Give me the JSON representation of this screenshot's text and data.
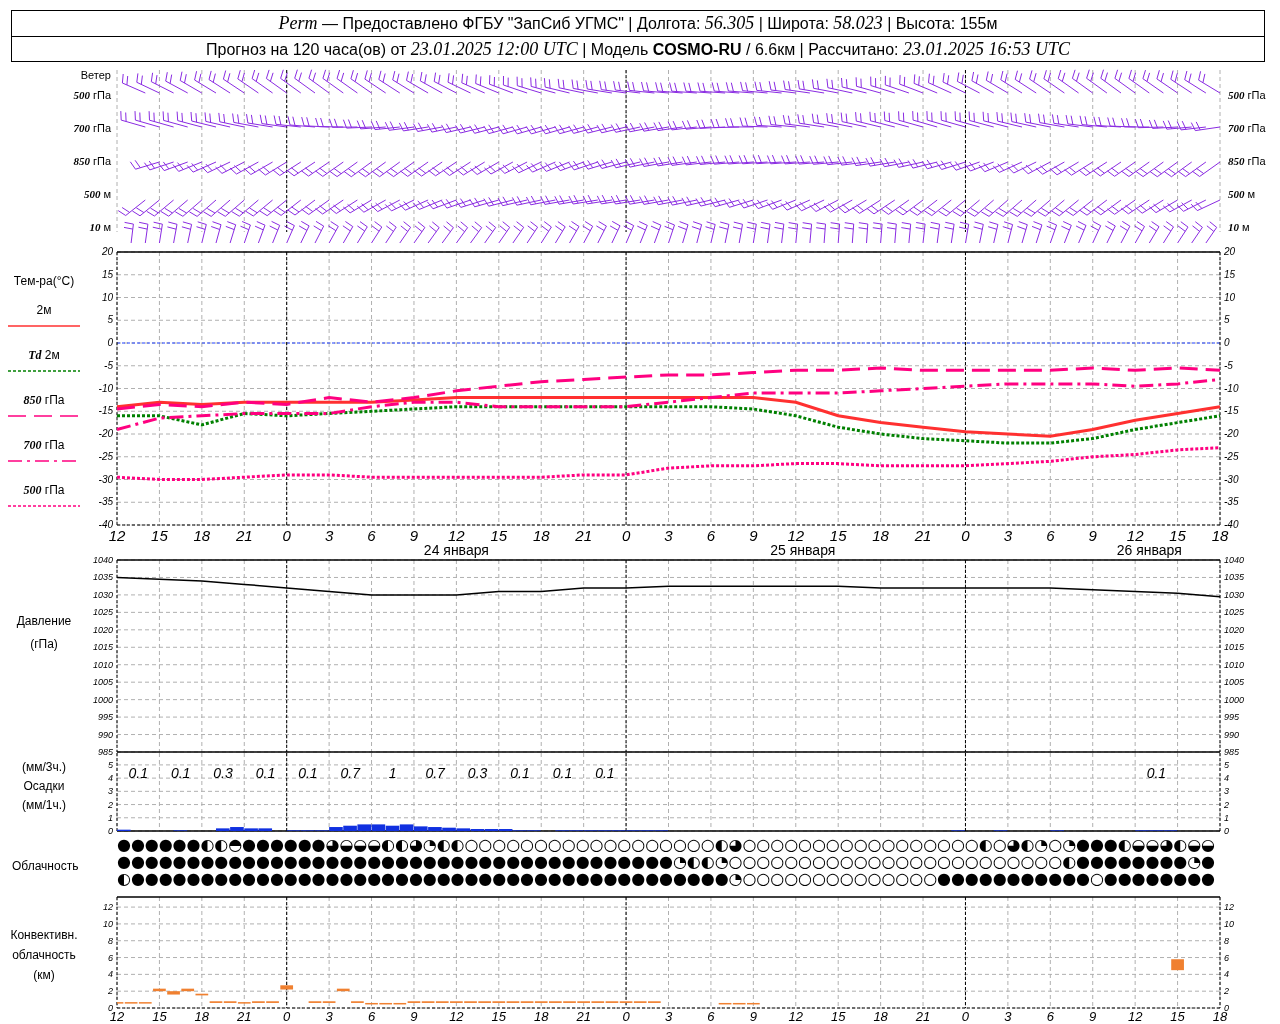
{
  "header": {
    "lines": [
      "*Perm* — Предоставлено ФГБУ \"ЗапСиб УГМС\" | Долгота: *56.305* | Широта: *58.023* | Высота: 155м",
      "Прогноз на 120 часа(ов) от *23.01.2025 12:00 UTC*  | Модель **COSMO-RU** / 6.6км | Рассчитано: *23.01.2025 16:53 UTC*"
    ]
  },
  "wind": {
    "title": "Ветер",
    "levels": [
      {
        "left_label": "*500* гПа",
        "right_label": "*500* гПа"
      },
      {
        "left_label": "*700* гПа",
        "right_label": "*700* гПа"
      },
      {
        "left_label": "*850* гПа",
        "right_label": "*850* гПа"
      },
      {
        "left_label": "*500* м",
        "right_label": "*500* м"
      },
      {
        "left_label": "*10*  м",
        "right_label": "*10*  м"
      }
    ]
  },
  "temperature": {
    "title": "Тем-ра(°С)",
    "date_labels": [
      "24 января",
      "25 января",
      "26 января"
    ],
    "right_axis_labels": [
      "20",
      "15",
      "10",
      "5",
      "0",
      "-5",
      "-10",
      "-15",
      "-20",
      "-25",
      "-30",
      "-35",
      "-40"
    ],
    "chart_data": {
      "type": "line",
      "grid": true,
      "categories": [
        "12",
        "15",
        "18",
        "21",
        "0",
        "3",
        "6",
        "9",
        "12",
        "15",
        "18",
        "21",
        "0",
        "3",
        "6",
        "9",
        "12",
        "15",
        "18",
        "21",
        "0",
        "3",
        "6",
        "9",
        "12",
        "15",
        "18"
      ],
      "ylim": [
        -40,
        20
      ],
      "yticks": [
        20,
        15,
        10,
        5,
        0,
        -5,
        -10,
        -15,
        -20,
        -25,
        -30,
        -35,
        -40
      ],
      "ref_lines": [
        {
          "axis": "y",
          "value": 0,
          "color": "#2040ff",
          "line_style": "dotted"
        }
      ],
      "series": [
        {
          "name": "2м",
          "color": "#ff3030",
          "line_style": "solid",
          "values": [
            -14,
            -13,
            -13.5,
            -13,
            -13,
            -13,
            -13,
            -12.5,
            -12,
            -12,
            -12,
            -12,
            -12,
            -12,
            -12,
            -12,
            -13,
            -16,
            -17.5,
            -18.5,
            -19.5,
            -20,
            -20.5,
            -19,
            -17,
            -15.5,
            -14
          ]
        },
        {
          "name": "*Td*  2м",
          "color": "#008000",
          "line_style": "dotted",
          "values": [
            -16,
            -16,
            -18,
            -15.5,
            -16,
            -15.5,
            -15,
            -14.5,
            -14,
            -14,
            -14,
            -14,
            -14,
            -14,
            -14,
            -14.5,
            -16,
            -18.5,
            -20,
            -21,
            -21.5,
            -22,
            -22,
            -21,
            -19,
            -17.5,
            -16
          ]
        },
        {
          "name": "*850* гПа",
          "color": "#ff0080",
          "line_style": "dashed",
          "values": [
            -14.5,
            -13.5,
            -14,
            -13,
            -13.5,
            -12,
            -13,
            -12,
            -10.5,
            -9.5,
            -8.5,
            -8,
            -7.5,
            -7,
            -7,
            -6.5,
            -6,
            -6,
            -5.5,
            -6,
            -6,
            -6,
            -6,
            -5.5,
            -6,
            -5.5,
            -6
          ]
        },
        {
          "name": "*700* гПа",
          "color": "#ff0080",
          "line_style": "dashdot",
          "values": [
            -19,
            -16.5,
            -16,
            -15.5,
            -15.5,
            -15.5,
            -14,
            -13,
            -13,
            -14,
            -14,
            -14,
            -14,
            -13,
            -12,
            -11,
            -11,
            -11,
            -10.5,
            -10,
            -9.5,
            -9,
            -9,
            -9,
            -9.5,
            -9,
            -8
          ]
        },
        {
          "name": "*500* гПа",
          "color": "#ff0080",
          "line_style": "dotted",
          "values": [
            -29.5,
            -30,
            -30,
            -29.5,
            -29,
            -29,
            -29.5,
            -29.5,
            -29.5,
            -29.5,
            -29.5,
            -29,
            -29,
            -27.5,
            -27,
            -27,
            -26.5,
            -26.5,
            -27,
            -27,
            -27,
            -26.5,
            -26,
            -25,
            -24.5,
            -23.5,
            -23
          ]
        }
      ]
    }
  },
  "pressure": {
    "labels": [
      "Давление",
      "(гПа)"
    ],
    "right_axis_labels": [
      "1040",
      "1035",
      "1030",
      "1025",
      "1020",
      "1015",
      "1010",
      "1005",
      "1000",
      "995",
      "990",
      "985"
    ],
    "chart_data": {
      "type": "line",
      "grid": true,
      "categories": [
        null,
        null,
        null,
        null,
        null,
        null,
        null,
        null,
        null,
        null,
        null,
        null,
        null,
        null,
        null,
        null,
        null,
        null,
        null,
        null,
        null,
        null,
        null,
        null,
        null,
        null,
        null
      ],
      "ylim": [
        985,
        1040
      ],
      "yticks": [
        1040,
        1035,
        1030,
        1025,
        1020,
        1015,
        1010,
        1005,
        1000,
        995,
        990,
        985
      ],
      "series": [
        {
          "color": "#000000",
          "line_style": "solid",
          "values": [
            1035,
            1034.5,
            1034,
            1033,
            1032,
            1031,
            1030,
            1030,
            1030,
            1031,
            1031,
            1032,
            1032,
            1032.5,
            1032.5,
            1032.5,
            1032.5,
            1032.5,
            1032,
            1032,
            1032,
            1032,
            1032,
            1031.5,
            1031,
            1030.5,
            1029.5
          ]
        }
      ]
    }
  },
  "precipitation": {
    "labels": [
      "(мм/3ч.)",
      "Осадки",
      "(мм/1ч.)"
    ],
    "totals_3h": [
      "0.1",
      "0.1",
      "0.3",
      "0.1",
      "0.1",
      "0.7",
      "1",
      "0.7",
      "0.3",
      "0.1",
      "0.1",
      "0.1",
      "0.1"
    ],
    "right_axis_labels": [
      "5",
      "4",
      "3",
      "2",
      "1",
      "0"
    ],
    "chart_data": {
      "type": "bar",
      "grid": true,
      "categories": [
        null,
        null,
        null,
        null,
        null,
        null,
        null,
        null,
        null,
        null,
        null,
        null,
        null,
        null,
        null,
        null,
        null,
        null,
        null,
        null,
        null,
        null,
        null,
        null,
        null,
        null,
        null,
        null,
        null,
        null,
        null,
        null,
        null,
        null,
        null,
        null,
        null,
        null,
        null,
        null,
        null,
        null,
        null,
        null,
        null,
        null,
        null,
        null,
        null,
        null,
        null,
        null,
        null,
        null,
        null,
        null,
        null,
        null,
        null,
        null,
        null,
        null,
        null,
        null,
        null,
        null,
        null,
        null,
        null,
        null,
        null,
        null,
        null,
        null,
        null,
        null,
        null,
        null
      ],
      "ylim": [
        0,
        5.9
      ],
      "yticks": [
        5,
        4,
        3,
        2,
        1,
        0
      ],
      "series": [
        {
          "color": "#1030e0",
          "values": [
            0.1,
            0,
            0,
            0,
            0.05,
            0,
            0,
            0.2,
            0.3,
            0.2,
            0.2,
            0,
            0.05,
            0.05,
            0.05,
            0.3,
            0.4,
            0.5,
            0.5,
            0.4,
            0.5,
            0.35,
            0.3,
            0.25,
            0.2,
            0.15,
            0.15,
            0.15,
            0.05,
            0.05,
            0,
            0.05,
            0.05,
            0.05,
            0.05,
            0.05,
            0.05,
            0.05,
            0.05,
            0,
            0,
            0,
            0,
            0,
            0,
            0,
            0,
            0,
            0,
            0,
            0,
            0,
            0,
            0,
            0,
            0,
            0,
            0,
            0,
            0.05,
            0,
            0,
            0.05,
            0,
            0,
            0,
            0.05,
            0,
            0,
            0,
            0,
            0,
            0.05,
            0.05,
            0.05,
            0,
            0,
            0
          ]
        }
      ]
    }
  },
  "cloudiness": {
    "label": "Облачность",
    "rows": [
      "●●●●●●◐◐◓●●●●●●◕◒◒◒◐◐◕◔◐◐○○○○○○○○○○○○○○○○○○◐◕○○○○○○○○○○○○○○○○○◐○◕◐◔○◔●●●◐◒◒◕◐◒◒",
      "●●●●●●●●●●●●●●●●●●●●●●●●●●●●●●●●●●●●●●●●◔◐◐◔○○○○○○○○○○○○○○○○○○○○○○○○◐●●●●●●●●◔●",
      "◐●●●●●●●●●●●●●●●●●●●●●●●●●●●●●●●●●●●●●●●●●●●◔○○○○○○○○○○○○○○●●●●●●●●●●●○●●●●●●●●"
    ]
  },
  "convective_clouds": {
    "labels": [
      "Конвективн.",
      "облачность",
      "(км)"
    ],
    "right_axis_labels": [
      "12",
      "10",
      "8",
      "6",
      "4",
      "2",
      "0"
    ],
    "chart_data": {
      "type": "candlestick",
      "grid": true,
      "categories": [
        "12",
        null,
        null,
        "15",
        null,
        null,
        "18",
        null,
        null,
        "21",
        null,
        null,
        "0",
        null,
        null,
        "3",
        null,
        null,
        "6",
        null,
        null,
        "9",
        null,
        null,
        "12",
        null,
        null,
        "15",
        null,
        null,
        "18",
        null,
        null,
        "21",
        null,
        null,
        "0",
        null,
        null,
        "3",
        null,
        null,
        "6",
        null,
        null,
        "9",
        null,
        null,
        "12",
        null,
        null,
        "15",
        null,
        null,
        "18",
        null,
        null,
        "21",
        null,
        null,
        "0",
        null,
        null,
        "3",
        null,
        null,
        "6",
        null,
        null,
        "9",
        null,
        null,
        "12",
        null,
        null,
        "15",
        null,
        null,
        "18"
      ],
      "ylim": [
        0,
        13.2
      ],
      "yticks": [
        12,
        10,
        8,
        6,
        4,
        2,
        0
      ],
      "series": [
        {
          "color": "#f08030",
          "ohlc": [
            [
              0.6,
              0.7,
              0.6,
              0.7
            ],
            [
              0.6,
              0.7,
              0.6,
              0.7
            ],
            [
              0.6,
              0.7,
              0.6,
              0.7
            ],
            [
              2.0,
              2.3,
              2.0,
              2.3
            ],
            [
              1.6,
              2.0,
              1.6,
              2.0
            ],
            [
              2.0,
              2.3,
              2.0,
              2.3
            ],
            [
              1.5,
              1.7,
              1.5,
              1.7
            ],
            [
              0.6,
              0.8,
              0.6,
              0.8
            ],
            [
              0.6,
              0.8,
              0.6,
              0.8
            ],
            [
              0.6,
              0.7,
              0.6,
              0.7
            ],
            [
              0.6,
              0.8,
              0.6,
              0.8
            ],
            [
              0.6,
              0.8,
              0.6,
              0.8
            ],
            [
              2.2,
              2.7,
              2.2,
              2.7
            ],
            null,
            [
              0.6,
              0.8,
              0.6,
              0.8
            ],
            [
              0.6,
              0.8,
              0.6,
              0.8
            ],
            [
              2.0,
              2.3,
              2.0,
              2.3
            ],
            [
              0.6,
              0.8,
              0.6,
              0.8
            ],
            [
              0.5,
              0.6,
              0.5,
              0.6
            ],
            [
              0.5,
              0.6,
              0.5,
              0.6
            ],
            [
              0.5,
              0.6,
              0.5,
              0.6
            ],
            [
              0.6,
              0.8,
              0.6,
              0.8
            ],
            [
              0.6,
              0.8,
              0.6,
              0.8
            ],
            [
              0.6,
              0.8,
              0.6,
              0.8
            ],
            [
              0.6,
              0.8,
              0.6,
              0.8
            ],
            [
              0.6,
              0.8,
              0.6,
              0.8
            ],
            [
              0.6,
              0.8,
              0.6,
              0.8
            ],
            [
              0.6,
              0.8,
              0.6,
              0.8
            ],
            [
              0.6,
              0.8,
              0.6,
              0.8
            ],
            [
              0.6,
              0.8,
              0.6,
              0.8
            ],
            [
              0.6,
              0.8,
              0.6,
              0.8
            ],
            [
              0.6,
              0.8,
              0.6,
              0.8
            ],
            [
              0.6,
              0.8,
              0.6,
              0.8
            ],
            [
              0.6,
              0.8,
              0.6,
              0.8
            ],
            [
              0.6,
              0.8,
              0.6,
              0.8
            ],
            [
              0.6,
              0.8,
              0.6,
              0.8
            ],
            [
              0.6,
              0.8,
              0.6,
              0.8
            ],
            [
              0.6,
              0.8,
              0.6,
              0.8
            ],
            [
              0.6,
              0.8,
              0.6,
              0.8
            ],
            null,
            null,
            null,
            null,
            [
              0.5,
              0.6,
              0.5,
              0.6
            ],
            [
              0.5,
              0.6,
              0.5,
              0.6
            ],
            [
              0.5,
              0.6,
              0.5,
              0.6
            ],
            null,
            null,
            null,
            null,
            null,
            null,
            null,
            null,
            null,
            null,
            null,
            null,
            null,
            null,
            null,
            null,
            null,
            null,
            null,
            null,
            null,
            null,
            null,
            null,
            null,
            null,
            null,
            null,
            null,
            [
              4.5,
              5.8,
              4.5,
              5.8
            ],
            null,
            null,
            null
          ]
        }
      ]
    }
  }
}
